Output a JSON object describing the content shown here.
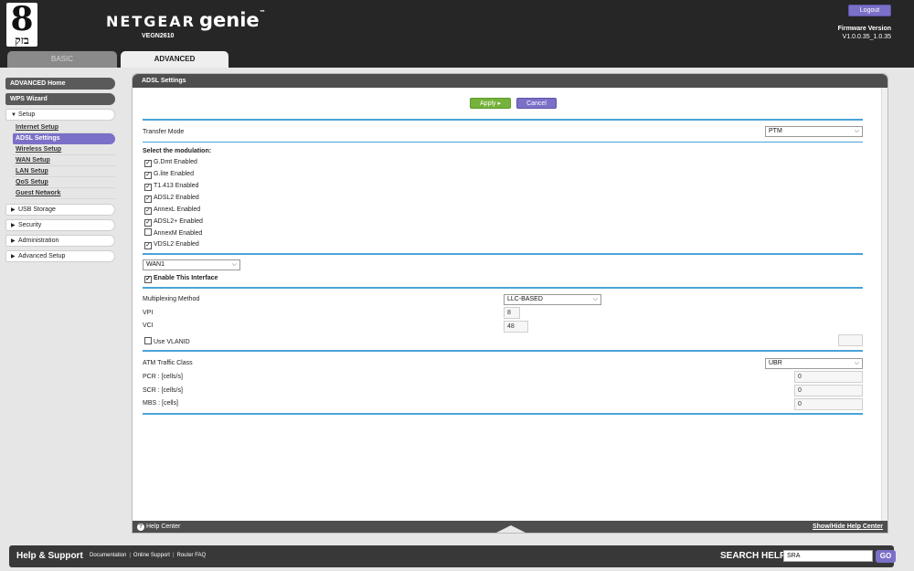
{
  "header": {
    "logo_glyph": "8",
    "logo_text": "בזק",
    "brand": "NETGEAR",
    "product": "genie",
    "trademark": "™",
    "model": "VEGN2610",
    "logout_label": "Logout",
    "firmware_label": "Firmware Version",
    "firmware_value": "V1.0.0.35_1.0.35",
    "tabs": [
      {
        "label": "BASIC",
        "active": false
      },
      {
        "label": "ADVANCED",
        "active": true
      }
    ]
  },
  "nav": {
    "advanced_home": "ADVANCED Home",
    "wps_wizard": "WPS Wizard",
    "setup": "Setup",
    "setup_items": [
      {
        "label": "Internet Setup",
        "active": false
      },
      {
        "label": "ADSL Settings",
        "active": true
      },
      {
        "label": "Wireless Setup",
        "active": false
      },
      {
        "label": "WAN Setup",
        "active": false
      },
      {
        "label": "LAN Setup",
        "active": false
      },
      {
        "label": "QoS Setup",
        "active": false
      },
      {
        "label": "Guest Network",
        "active": false
      }
    ],
    "usb_storage": "USB Storage",
    "security": "Security",
    "administration": "Administration",
    "advanced_setup": "Advanced Setup"
  },
  "panel": {
    "title": "ADSL Settings",
    "apply_label": "Apply ▸",
    "cancel_label": "Cancel",
    "transfer_mode_label": "Transfer Mode",
    "transfer_mode_value": "PTM",
    "modulation_label": "Select the modulation:",
    "modulations": [
      {
        "label": "G.Dmt Enabled",
        "checked": true
      },
      {
        "label": "G.lite Enabled",
        "checked": true
      },
      {
        "label": "T1.413 Enabled",
        "checked": true
      },
      {
        "label": "ADSL2 Enabled",
        "checked": true
      },
      {
        "label": "AnnexL Enabled",
        "checked": true
      },
      {
        "label": "ADSL2+ Enabled",
        "checked": true
      },
      {
        "label": "AnnexM Enabled",
        "checked": false
      },
      {
        "label": "VDSL2 Enabled",
        "checked": true
      }
    ],
    "wan_value": "WAN1",
    "enable_interface_label": "Enable This Interface",
    "enable_interface_checked": true,
    "multiplexing_label": "Multiplexing Method",
    "multiplexing_value": "LLC-BASED",
    "vpi_label": "VPI",
    "vpi_value": "8",
    "vci_label": "VCI",
    "vci_value": "48",
    "vlanid_label": "Use VLANID",
    "vlanid_checked": false,
    "vlanid_value": "",
    "atm_label": "ATM Traffic Class",
    "atm_value": "UBR",
    "pcr_label": "PCR : [cells/s]",
    "pcr_value": "0",
    "scr_label": "SCR : [cells/s]",
    "scr_value": "0",
    "mbs_label": "MBS : [cells]",
    "mbs_value": "0",
    "help_center": "Help Center",
    "show_hide_help": "Show/Hide Help Center"
  },
  "footer": {
    "title": "Help & Support",
    "links": [
      "Documentation",
      "Online Support",
      "Router FAQ"
    ],
    "search_label": "SEARCH HELP",
    "search_value": "SRA",
    "go_label": "GO"
  },
  "colors": {
    "accent": "#7a70c8",
    "apply_green": "#74b23b",
    "rule_blue": "#4aa3d8",
    "header_dark": "#262626"
  },
  "icons": [
    "dropdown-chevron-icon",
    "checkbox-icon",
    "help-icon",
    "expand-triangle-icon"
  ]
}
